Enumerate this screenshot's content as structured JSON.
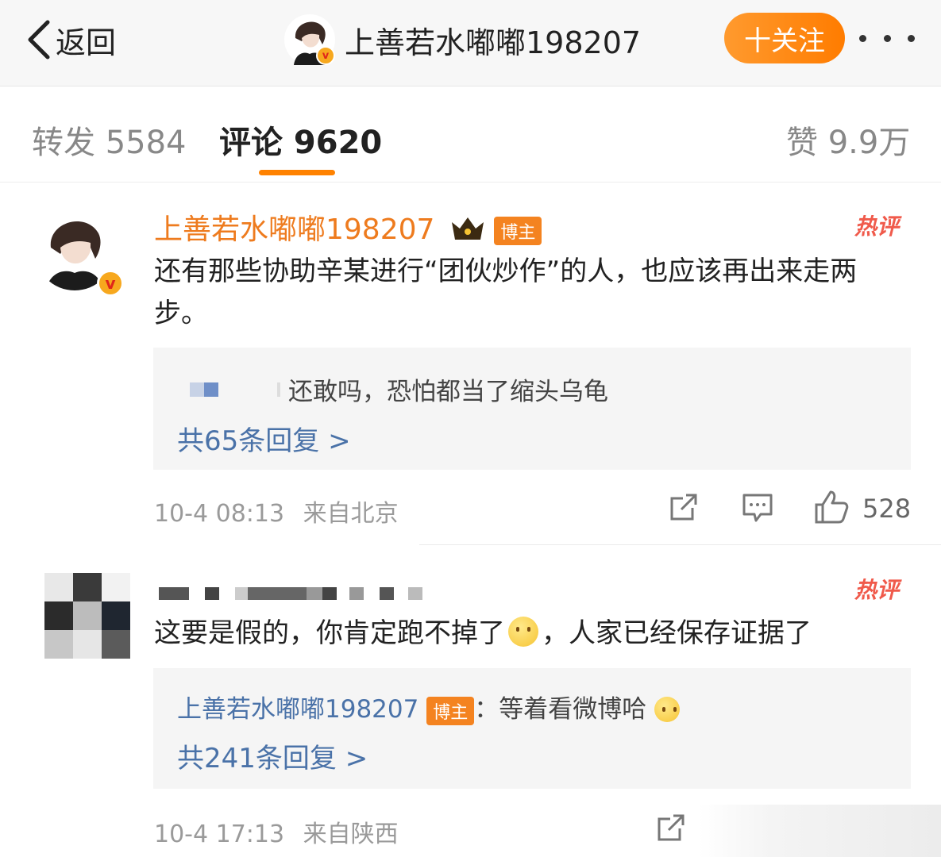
{
  "header": {
    "back_label": "返回",
    "author_name": "上善若水嘟嘟198207",
    "follow_label": "十关注"
  },
  "tabs": {
    "repost": "转发 5584",
    "comments": "评论 9620",
    "likes": "赞 9.9万"
  },
  "comments": [
    {
      "author": "上善若水嘟嘟198207",
      "author_badge": "博主",
      "hot_tag": "热评",
      "text": "还有那些协助辛某进行“团伙炒作”的人，也应该再出来走两步。",
      "reply_preview": "还敢吗，恐怕都当了缩头乌龟",
      "reply_count_label": "共65条回复 >",
      "time": "10-4 08:13",
      "location": "来自北京",
      "like_count": "528"
    },
    {
      "hot_tag": "热评",
      "text_before": "这要是假的，你肯定跑不掉了",
      "text_after": "，人家已经保存证据了",
      "reply_author": "上善若水嘟嘟198207",
      "reply_author_badge": "博主",
      "reply_text": "：等着看微博哈",
      "reply_count_label": "共241条回复 >",
      "time": "10-4 17:13",
      "location": "来自陕西"
    }
  ]
}
